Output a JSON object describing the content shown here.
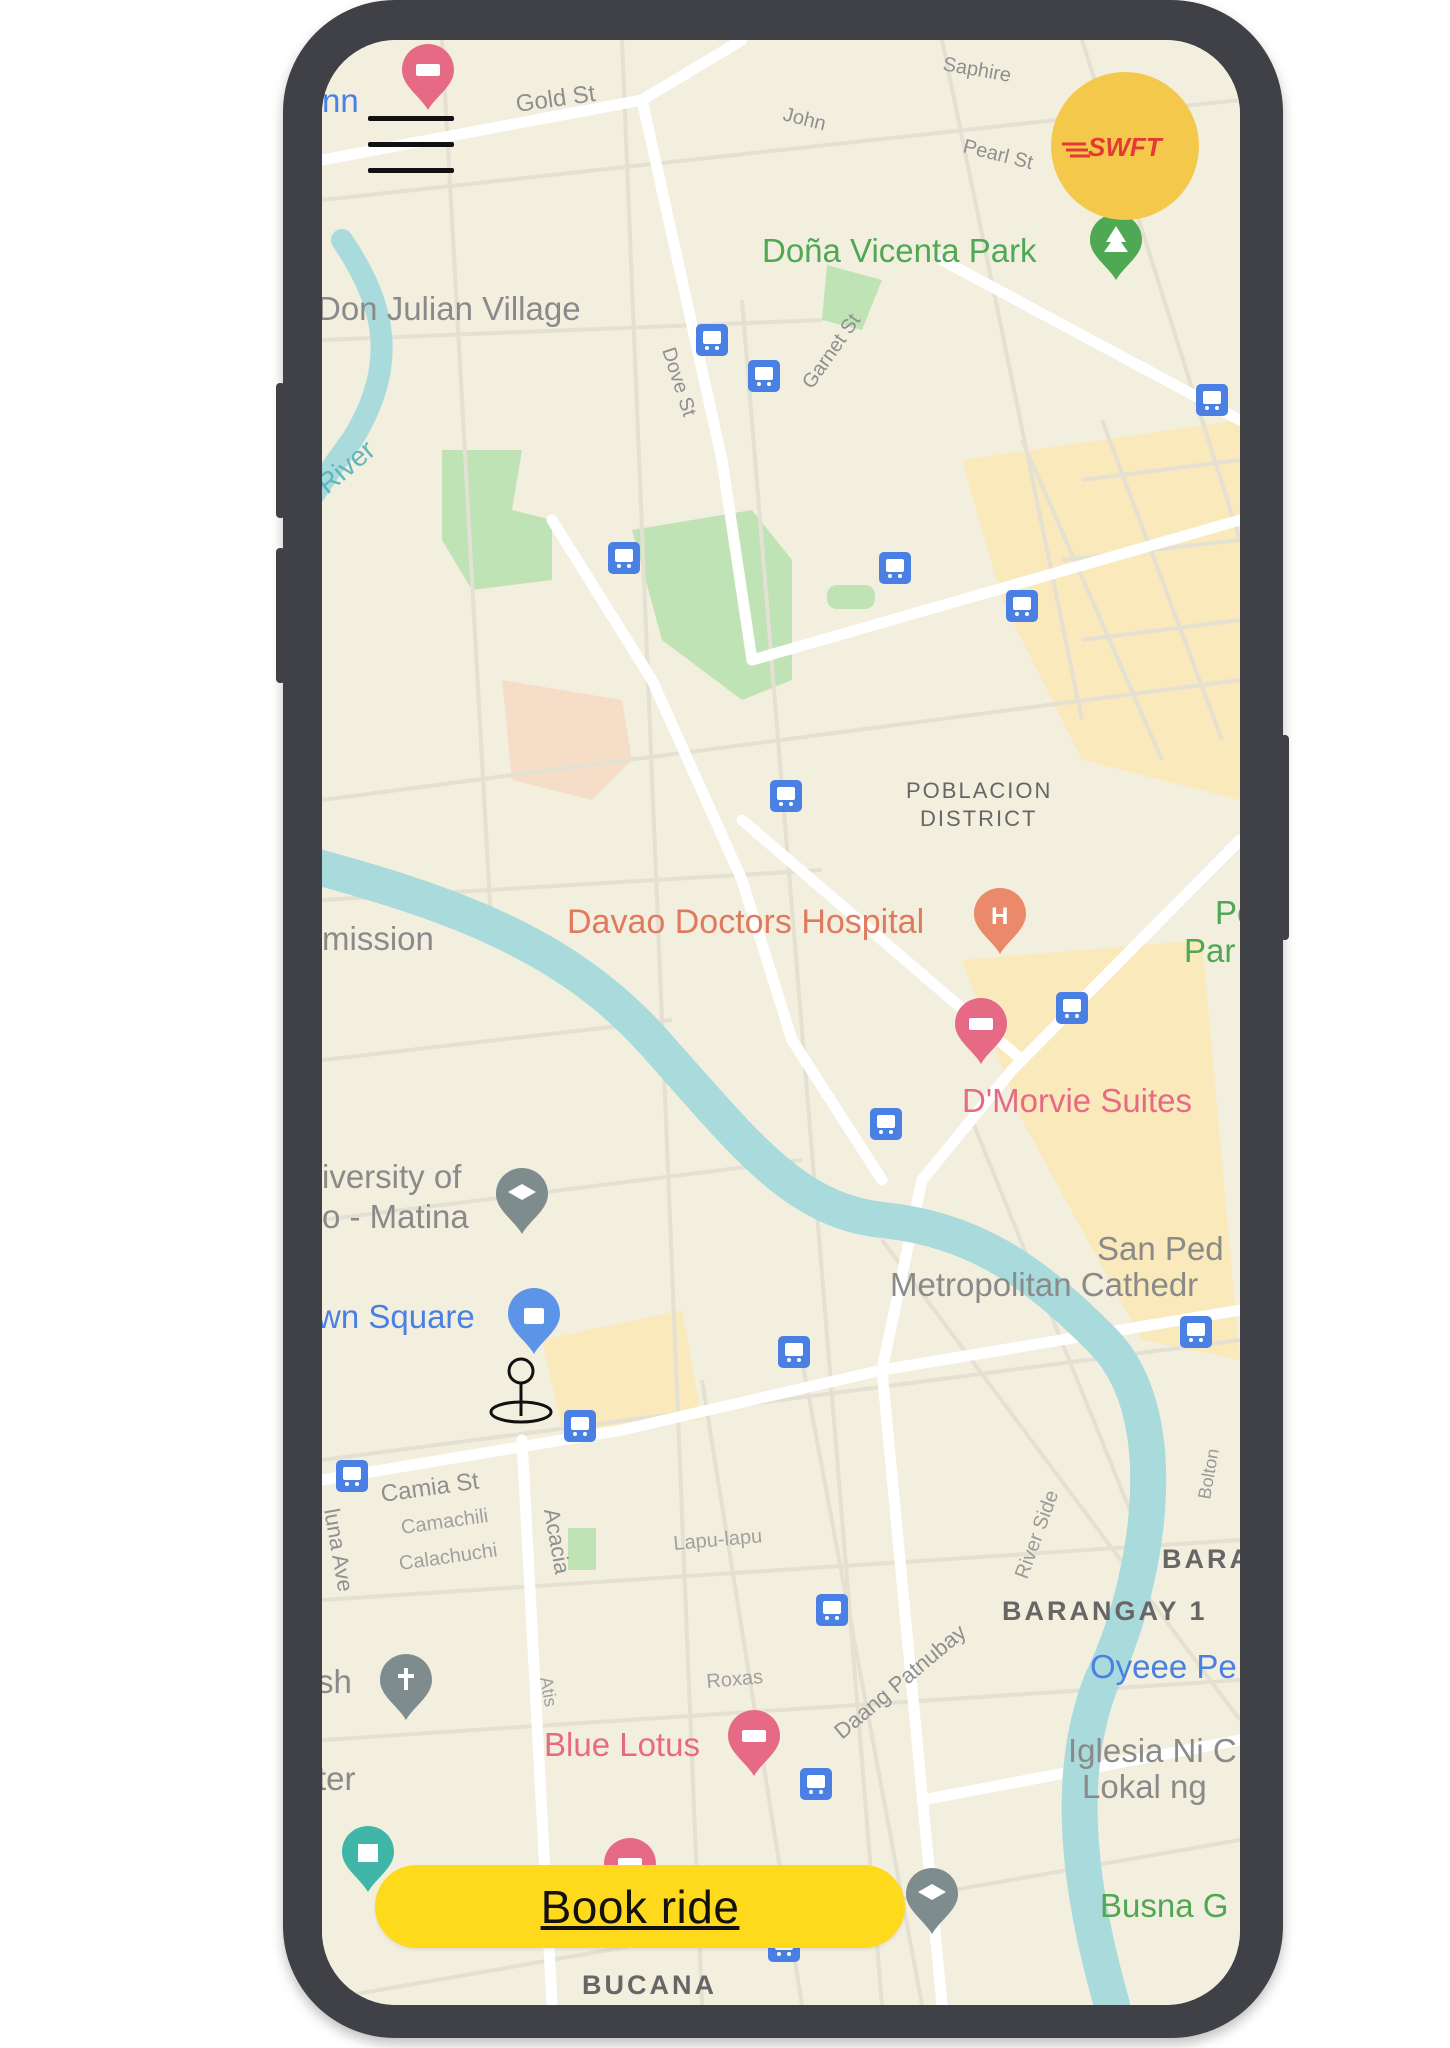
{
  "app": {
    "logo_text": "SWFT"
  },
  "actions": {
    "book_ride_label": "Book ride"
  },
  "map": {
    "labels": {
      "gold_st": "Gold St",
      "john": "John",
      "pearl_st": "Pearl St",
      "saphire": "Saphire",
      "dona_vicenta_park": "Doña Vicenta Park",
      "don_julian_village": "Don Julian Village",
      "dove_st": "Dove St",
      "garnet_st": "Garnet St",
      "river": "River",
      "poblacion_1": "POBLACION",
      "poblacion_2": "DISTRICT",
      "davao_doctors_hospital": "Davao Doctors Hospital",
      "pa_1": "Pe",
      "pa_2": "Par",
      "mission": "mission",
      "d_morvie_suites": "D'Morvie Suites",
      "university_1": "iversity of",
      "university_2": "o - Matina",
      "san_pedro": "San Ped",
      "metropolitan_cathedral": "Metropolitan Cathedr",
      "town_square": "wn Square",
      "camia_st": "Camia St",
      "camachili": "Camachili",
      "calachuchi": "Calachuchi",
      "acacia": "Acacia",
      "luna_ave": "luna Ave",
      "lapu_lapu": "Lapu-lapu",
      "river_side": "River Side",
      "bolton": "Bolton",
      "bara": "BARA",
      "barangay": "BARANGAY 1",
      "oyeee": "Oyeee Pe",
      "daang_patnubay": "Daang Patnubay",
      "roxas": "Roxas",
      "atis": "Atis",
      "sh": "sh",
      "blue_lotus": "Blue Lotus",
      "iglesia_1": "Iglesia Ni C",
      "iglesia_2": "Lokal ng",
      "ter": "ter",
      "busna": "Busna G",
      "bucana": "BUCANA",
      "nn": "nn"
    }
  },
  "colors": {
    "map_bg": "#f3efdf",
    "water": "#a9dadc",
    "park": "#bfe3b4",
    "road": "#ffffff",
    "zone": "#fbe7b0",
    "transit": "#4a80e4",
    "hospital": "#ea8a6b",
    "lodging": "#e66a86",
    "book_button": "#ffd91c",
    "logo_bg": "#f3c84b",
    "logo_text": "#e53935"
  }
}
